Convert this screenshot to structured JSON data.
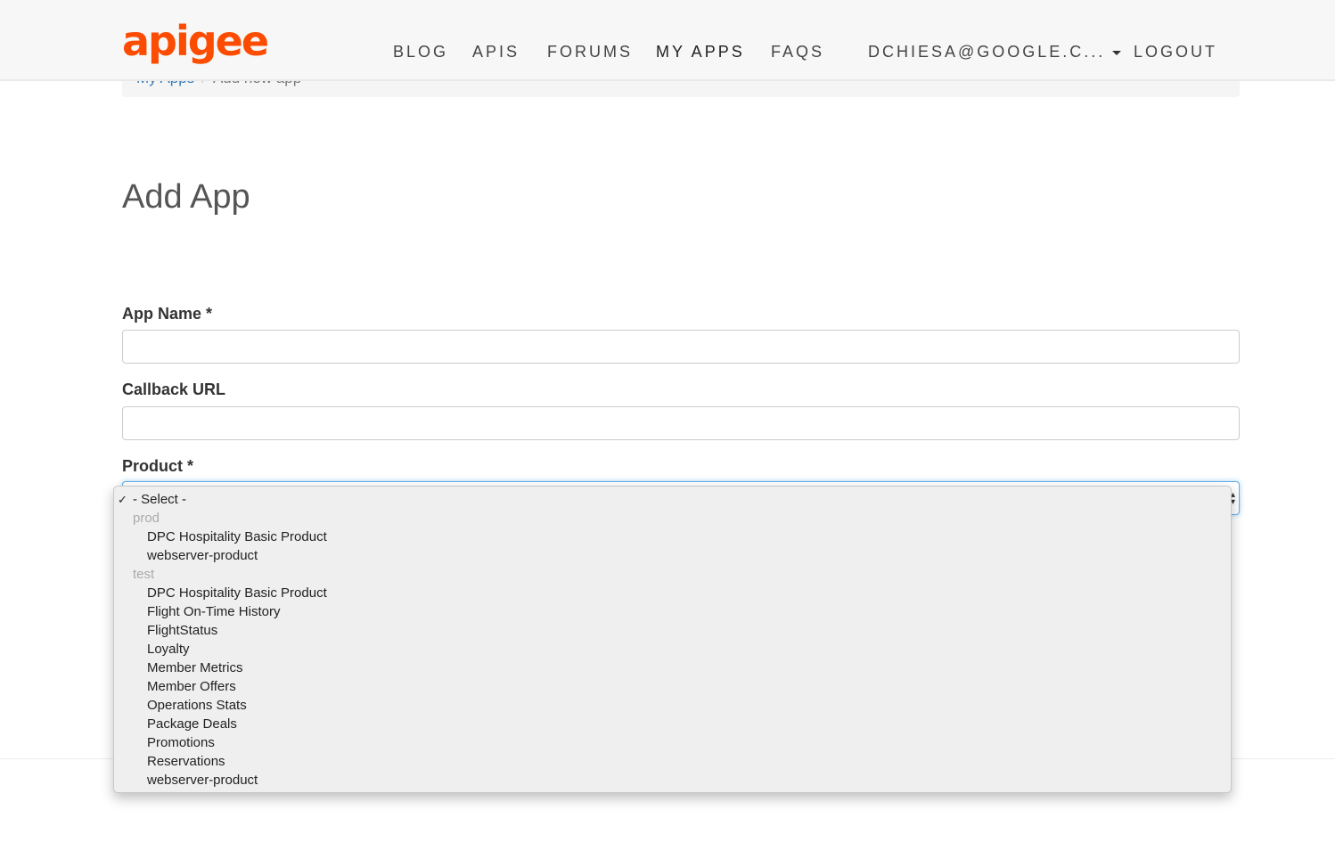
{
  "header": {
    "logo": "apigee",
    "nav": [
      {
        "label": "BLOG"
      },
      {
        "label": "APIS"
      },
      {
        "label": "FORUMS"
      },
      {
        "label": "MY APPS"
      },
      {
        "label": "FAQS"
      }
    ],
    "user": "DCHIESA@GOOGLE.C...",
    "logout": "LOGOUT",
    "brand_color": "#fc4c02"
  },
  "breadcrumb": {
    "parent": "My Apps",
    "separator": "/",
    "current": "Add new app"
  },
  "page": {
    "title": "Add App"
  },
  "form": {
    "app_name_label": "App Name *",
    "app_name_value": "",
    "callback_label": "Callback URL",
    "callback_value": "",
    "product_label": "Product *"
  },
  "dropdown": {
    "selected": "- Select -",
    "check": "✓",
    "groups": [
      {
        "name": "prod",
        "items": [
          "DPC Hospitality Basic Product",
          "webserver-product"
        ]
      },
      {
        "name": "test",
        "items": [
          "DPC Hospitality Basic Product",
          "Flight On-Time History",
          "FlightStatus",
          "Loyalty",
          "Member Metrics",
          "Member Offers",
          "Operations Stats",
          "Package Deals",
          "Promotions",
          "Reservations",
          "webserver-product"
        ]
      }
    ]
  }
}
